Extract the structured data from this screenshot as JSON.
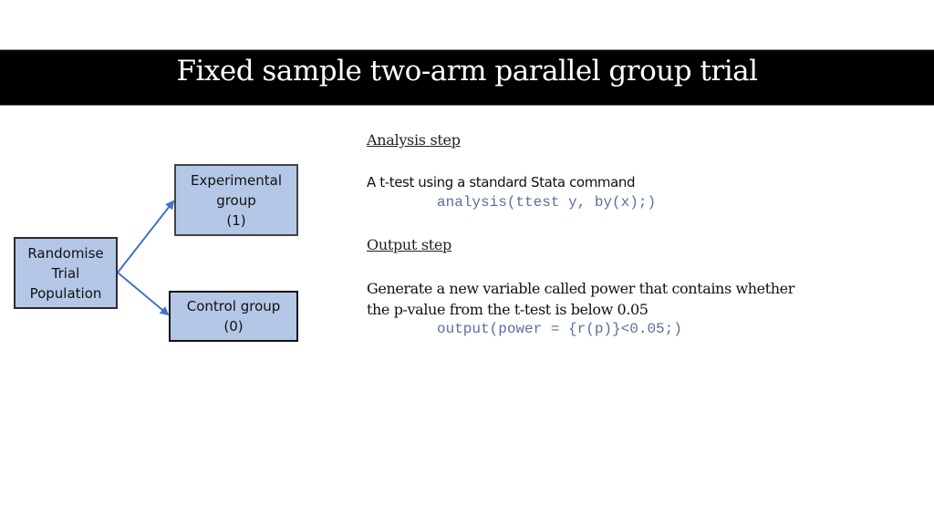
{
  "title": "Fixed sample two-arm parallel group trial",
  "diagram": {
    "nodes": {
      "randomise": [
        "Randomise",
        "Trial",
        "Population"
      ],
      "experimental": [
        "Experimental",
        "group",
        "(1)"
      ],
      "control": [
        "Control group",
        "(0)"
      ]
    },
    "colors": {
      "box_fill": "#b4c7e7",
      "arrow": "#4472c4"
    }
  },
  "analysis": {
    "heading": "Analysis step",
    "description": "A t-test using a standard Stata command",
    "code": "analysis(ttest y, by(x);)"
  },
  "output": {
    "heading": "Output step",
    "description_line1": "Generate a new variable called power that contains whether",
    "description_line2": "the p-value from the t-test is below 0.05",
    "code": "output(power = {r(p)}<0.05;)"
  }
}
